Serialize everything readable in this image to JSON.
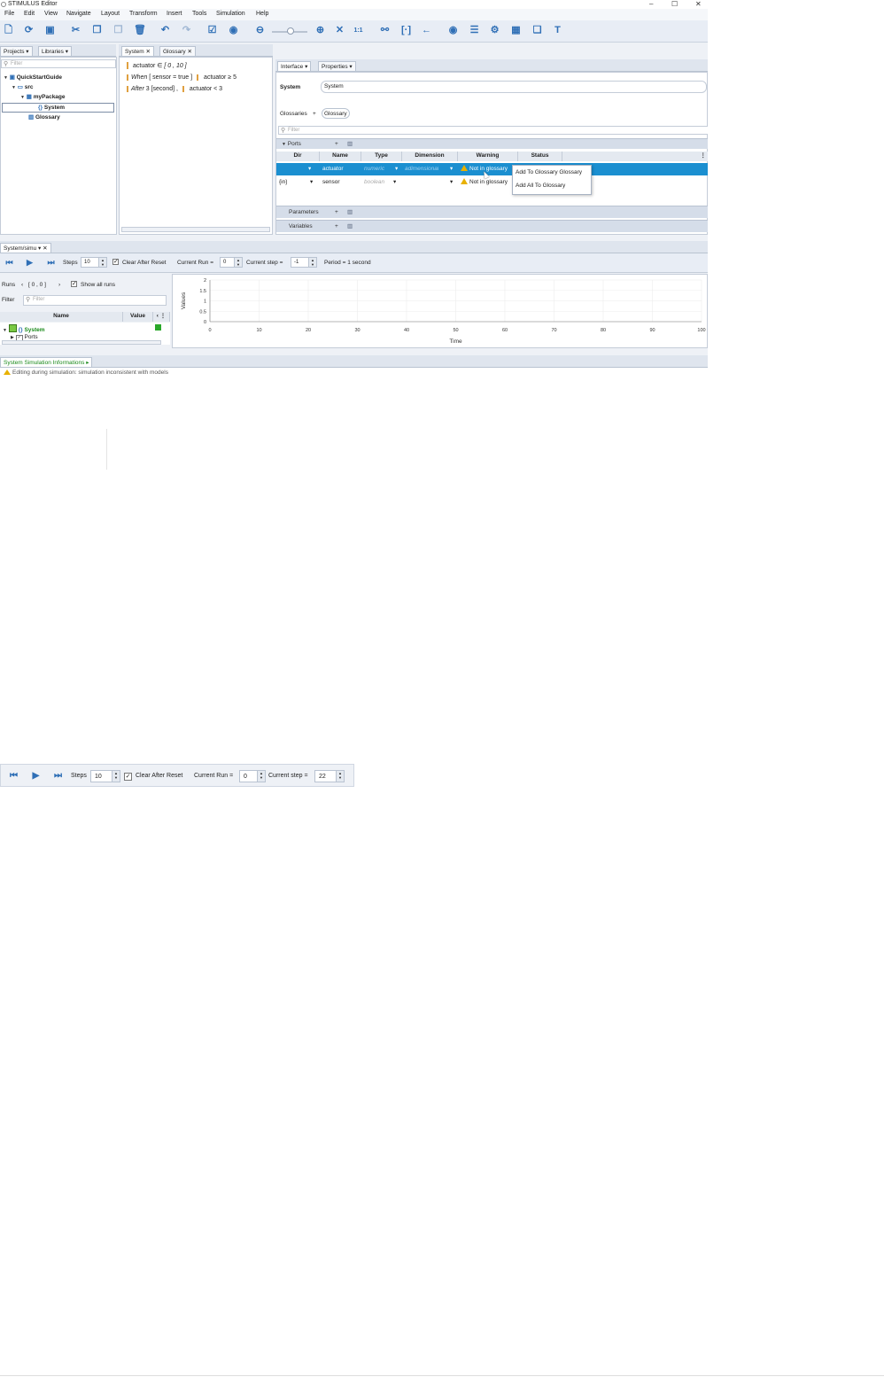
{
  "window": {
    "title": "STIMULUS Editor",
    "minimize": "–",
    "maximize": "☐",
    "close": "✕"
  },
  "menu": [
    "File",
    "Edit",
    "View",
    "Navigate",
    "Layout",
    "Transform",
    "Insert",
    "Tools",
    "Simulation",
    "Help"
  ],
  "toolbar": {
    "icons": [
      "new-file-icon",
      "open-icon",
      "save-icon",
      "cut-icon",
      "copy-icon",
      "paste-icon",
      "delete-icon",
      "undo-icon",
      "redo-icon",
      "validate-icon",
      "run-icon",
      "zoom-out-icon",
      "zoom-slider",
      "zoom-in-icon",
      "fit-icon",
      "actual-size-icon",
      "link-icon",
      "bracket-icon",
      "arrow-icon",
      "eye-icon",
      "list-icon",
      "components-icon",
      "layout-icon",
      "copy-window-icon",
      "text-icon"
    ],
    "actual_size": "1:1"
  },
  "projects": {
    "tab_projects": "Projects",
    "tab_libraries": "Libraries",
    "filter_placeholder": "Filter",
    "tree": [
      {
        "label": "QuickStartGuide",
        "level": 0
      },
      {
        "label": "src",
        "level": 1
      },
      {
        "label": "myPackage",
        "level": 2
      },
      {
        "label": "System",
        "level": 3,
        "selected": true
      },
      {
        "label": "Glossary",
        "level": 2
      }
    ]
  },
  "editor": {
    "tab_system": "System",
    "tab_glossary": "Glossary",
    "lines": [
      {
        "parts": [
          "actuator",
          "∈",
          "[ 0 ,",
          "10 ]"
        ]
      },
      {
        "keyword": "When",
        "rest": "[ sensor  =  true ]",
        "action": "actuator  ≥  5"
      },
      {
        "keyword": "After",
        "rest": "3 [second] ,",
        "action": "actuator  <  3"
      }
    ]
  },
  "interface": {
    "tab_interface": "Interface",
    "tab_properties": "Properties",
    "system_label": "System",
    "system_value": "System",
    "glossaries_label": "Glossaries",
    "glossaries_add": "+",
    "glossary_chip": "Glossary",
    "filter_placeholder": "Filter",
    "ports_label": "Ports",
    "columns": [
      "Dir",
      "Name",
      "Type",
      "Dimension",
      "Warning",
      "Status"
    ],
    "rows": [
      {
        "dir": "",
        "name": "actuator",
        "type": "numeric",
        "dimension": "adimensional",
        "warning": "Not in glossary",
        "status": "",
        "selected": true
      },
      {
        "dir": "{in}",
        "name": "sensor",
        "type": "boolean",
        "dimension": "",
        "warning": "Not in glossary",
        "status": ""
      }
    ],
    "context_menu": [
      "Add To Glossary Glossary",
      "Add All To Glossary"
    ],
    "parameters_label": "Parameters",
    "variables_label": "Variables"
  },
  "simulation": {
    "tab": "System/simu",
    "steps_label": "Steps",
    "steps_value": "10",
    "clear_after_reset": "Clear After Reset",
    "current_run_label": "Current Run =",
    "current_run_value": "0",
    "current_step_label": "Current step =",
    "current_step_value": "-1",
    "period": "Period = 1 second",
    "runs_label": "Runs",
    "runs_range": "[ 0 , 0 ]",
    "show_all_runs": "Show all runs",
    "filter_label": "Filter",
    "filter_placeholder": "Filter",
    "col_name": "Name",
    "col_value": "Value",
    "tree_system": "System",
    "tree_ports": "Ports"
  },
  "chart_data": {
    "type": "line",
    "xlabel": "Time",
    "ylabel": "Values",
    "xlim": [
      0,
      100
    ],
    "ylim": [
      0,
      2
    ],
    "x_ticks": [
      "0",
      "10",
      "20",
      "30",
      "40",
      "50",
      "60",
      "70",
      "80",
      "90",
      "100"
    ],
    "y_ticks": [
      "0",
      "0.5",
      "1",
      "1.5",
      "2"
    ],
    "series": [],
    "grid": true
  },
  "info": {
    "tab": "System Simulation Informations",
    "message": "Editing during simulation: simulation inconsistent with models"
  },
  "sim_toolbar_2": {
    "steps_label": "Steps",
    "steps_value": "10",
    "clear_after_reset": "Clear After Reset",
    "current_run_label": "Current Run =",
    "current_run_value": "0",
    "current_step_label": "Current step =",
    "current_step_value": "22"
  }
}
